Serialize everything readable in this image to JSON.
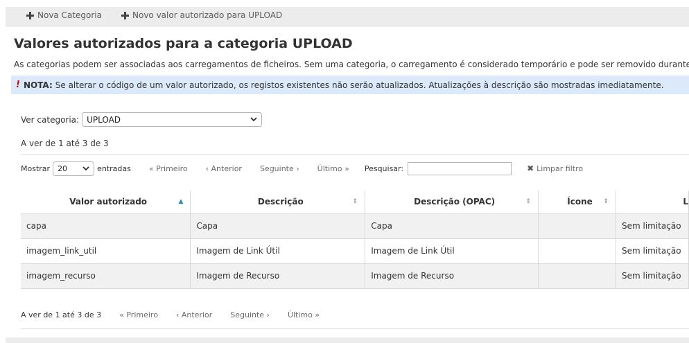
{
  "toolbar": {
    "new_category": "Nova Categoria",
    "new_value": "Novo valor autorizado para UPLOAD"
  },
  "page": {
    "title": "Valores autorizados para a categoria UPLOAD",
    "intro": "As categorias podem ser associadas aos carregamentos de ficheiros. Sem uma categoria, o carregamento é considerado temporário e pode ser removido durante ur",
    "note_label": "NOTA:",
    "note_text": "Se alterar o código de um valor autorizado, os registos existentes não serão atualizados. Atualizações à descrição são mostradas imediatamente."
  },
  "filter": {
    "category_label": "Ver categoria:",
    "category_value": "UPLOAD",
    "count_text": "A ver de 1 até 3 de 3"
  },
  "controls": {
    "show_label": "Mostrar",
    "page_length": "20",
    "entries_label": "entradas",
    "first": "« Primeiro",
    "previous": "‹ Anterior",
    "next": "Seguinte ›",
    "last": "Último »",
    "search_label": "Pesquisar:",
    "search_value": "",
    "clear_filter": "Limpar filtro"
  },
  "table": {
    "columns": [
      "Valor autorizado",
      "Descrição",
      "Descrição (OPAC)",
      "Ícone",
      "L"
    ],
    "rows": [
      [
        "capa",
        "Capa",
        "Capa",
        "",
        "Sem limitação"
      ],
      [
        "imagem_link_util",
        "Imagem de Link Útil",
        "Imagem de Link Útil",
        "",
        "Sem limitação"
      ],
      [
        "imagem_recurso",
        "Imagem de Recurso",
        "Imagem de Recurso",
        "",
        "Sem limitação"
      ]
    ]
  },
  "footer": {
    "count_text": "A ver de 1 até 3 de 3",
    "first": "« Primeiro",
    "previous": "‹ Anterior",
    "next": "Seguinte ›",
    "last": "Último »"
  },
  "icons": {
    "add": "plus-icon",
    "clear": "x-icon",
    "sort_asc": "sort-asc-icon",
    "sort_both": "sort-both-icon",
    "note": "exclamation-icon"
  },
  "colors": {
    "note_background": "#dbe9fa",
    "note_exclamation": "#cc0000",
    "page_background": "#ececec",
    "odd_row": "#f1f1f1",
    "sort_active": "#2e86c1"
  }
}
